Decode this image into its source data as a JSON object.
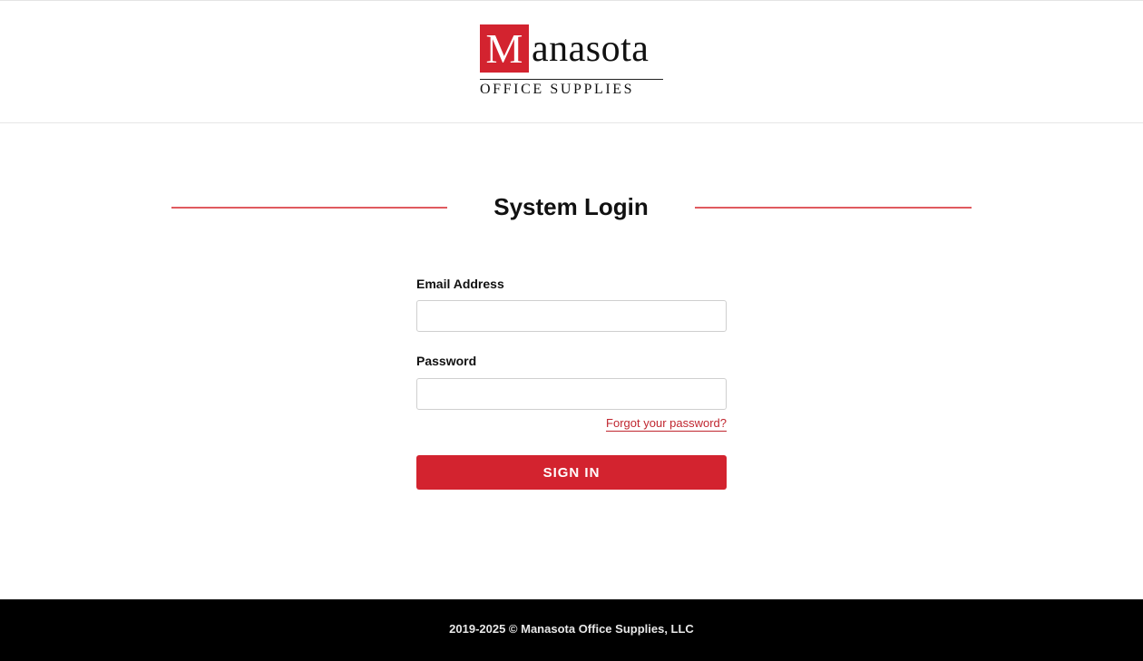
{
  "logo": {
    "initial": "M",
    "name_rest": "anasota",
    "subtitle": "OFFICE SUPPLIES",
    "brand_color": "#d3232f"
  },
  "login": {
    "title": "System Login",
    "email_label": "Email Address",
    "email_value": "",
    "password_label": "Password",
    "password_value": "",
    "forgot_link": "Forgot your password?",
    "sign_in_label": "SIGN IN",
    "accent_color": "#d3232f"
  },
  "footer": {
    "copyright": "2019-2025 © Manasota Office Supplies, LLC"
  }
}
